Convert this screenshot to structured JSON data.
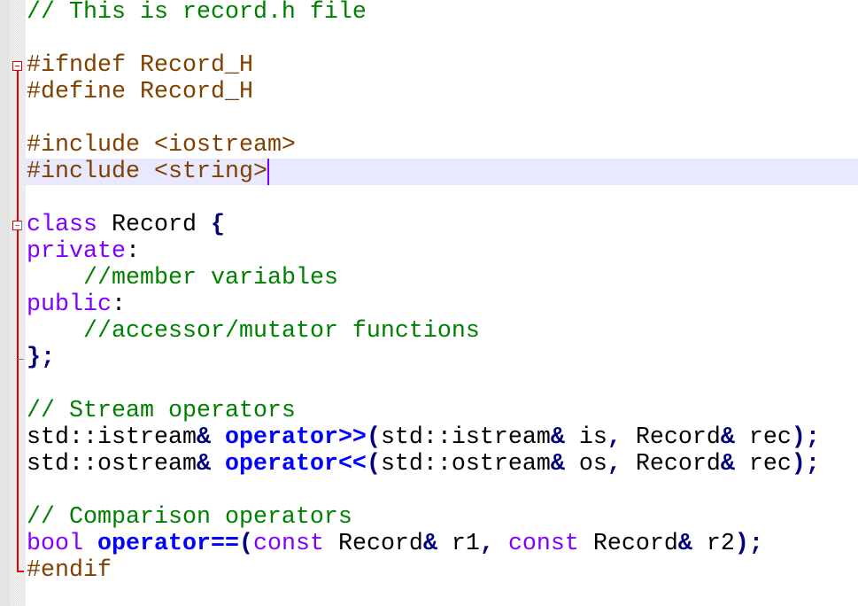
{
  "editor": {
    "file_description": "record.h header file",
    "current_line": 7,
    "colors": {
      "comment": "#008000",
      "preprocessor": "#804000",
      "keyword": "#8000ff",
      "operator_keyword": "#0000ff",
      "punctuation": "#000080",
      "identifier": "#000000",
      "current_line_bg": "#e8e8ff",
      "fold_marker": "#e00000",
      "caret": "#8000ff"
    },
    "lines": [
      {
        "tokens": [
          {
            "t": "// This is record.h file",
            "c": "comment"
          }
        ]
      },
      {
        "tokens": []
      },
      {
        "tokens": [
          {
            "t": "#ifndef Record_H",
            "c": "preproc"
          }
        ]
      },
      {
        "tokens": [
          {
            "t": "#define Record_H",
            "c": "preproc"
          }
        ]
      },
      {
        "tokens": []
      },
      {
        "tokens": [
          {
            "t": "#include <iostream>",
            "c": "preproc"
          }
        ]
      },
      {
        "tokens": [
          {
            "t": "#include <string>",
            "c": "preproc"
          }
        ]
      },
      {
        "tokens": []
      },
      {
        "tokens": [
          {
            "t": "class",
            "c": "keyword"
          },
          {
            "t": " Record ",
            "c": "ident"
          },
          {
            "t": "{",
            "c": "punct"
          }
        ]
      },
      {
        "tokens": [
          {
            "t": "private",
            "c": "keyword"
          },
          {
            "t": ":",
            "c": "ident"
          }
        ]
      },
      {
        "tokens": [
          {
            "t": "    ",
            "c": "ident"
          },
          {
            "t": "//member variables",
            "c": "comment"
          }
        ]
      },
      {
        "tokens": [
          {
            "t": "public",
            "c": "keyword"
          },
          {
            "t": ":",
            "c": "ident"
          }
        ]
      },
      {
        "tokens": [
          {
            "t": "    ",
            "c": "ident"
          },
          {
            "t": "//accessor/mutator functions",
            "c": "comment"
          }
        ]
      },
      {
        "tokens": [
          {
            "t": "}",
            "c": "punct"
          },
          {
            "t": ";",
            "c": "punct"
          }
        ]
      },
      {
        "tokens": []
      },
      {
        "tokens": [
          {
            "t": "// Stream operators",
            "c": "comment"
          }
        ]
      },
      {
        "tokens": [
          {
            "t": "std::istream",
            "c": "ident"
          },
          {
            "t": "&",
            "c": "punct"
          },
          {
            "t": " ",
            "c": "ident"
          },
          {
            "t": "operator>>",
            "c": "opkw"
          },
          {
            "t": "(",
            "c": "punct"
          },
          {
            "t": "std::istream",
            "c": "ident"
          },
          {
            "t": "&",
            "c": "punct"
          },
          {
            "t": " is",
            "c": "ident"
          },
          {
            "t": ",",
            "c": "punct"
          },
          {
            "t": " Record",
            "c": "ident"
          },
          {
            "t": "&",
            "c": "punct"
          },
          {
            "t": " rec",
            "c": "ident"
          },
          {
            "t": ");",
            "c": "punct"
          }
        ]
      },
      {
        "tokens": [
          {
            "t": "std::ostream",
            "c": "ident"
          },
          {
            "t": "&",
            "c": "punct"
          },
          {
            "t": " ",
            "c": "ident"
          },
          {
            "t": "operator<<",
            "c": "opkw"
          },
          {
            "t": "(",
            "c": "punct"
          },
          {
            "t": "std::ostream",
            "c": "ident"
          },
          {
            "t": "&",
            "c": "punct"
          },
          {
            "t": " os",
            "c": "ident"
          },
          {
            "t": ",",
            "c": "punct"
          },
          {
            "t": " Record",
            "c": "ident"
          },
          {
            "t": "&",
            "c": "punct"
          },
          {
            "t": " rec",
            "c": "ident"
          },
          {
            "t": ");",
            "c": "punct"
          }
        ]
      },
      {
        "tokens": []
      },
      {
        "tokens": [
          {
            "t": "// Comparison operators",
            "c": "comment"
          }
        ]
      },
      {
        "tokens": [
          {
            "t": "bool",
            "c": "keyword"
          },
          {
            "t": " ",
            "c": "ident"
          },
          {
            "t": "operator==",
            "c": "opkw"
          },
          {
            "t": "(",
            "c": "punct"
          },
          {
            "t": "const",
            "c": "keyword"
          },
          {
            "t": " Record",
            "c": "ident"
          },
          {
            "t": "&",
            "c": "punct"
          },
          {
            "t": " r1",
            "c": "ident"
          },
          {
            "t": ",",
            "c": "punct"
          },
          {
            "t": " ",
            "c": "ident"
          },
          {
            "t": "const",
            "c": "keyword"
          },
          {
            "t": " Record",
            "c": "ident"
          },
          {
            "t": "&",
            "c": "punct"
          },
          {
            "t": " r2",
            "c": "ident"
          },
          {
            "t": ");",
            "c": "punct"
          }
        ]
      },
      {
        "tokens": [
          {
            "t": "#endif",
            "c": "preproc"
          }
        ]
      }
    ]
  }
}
